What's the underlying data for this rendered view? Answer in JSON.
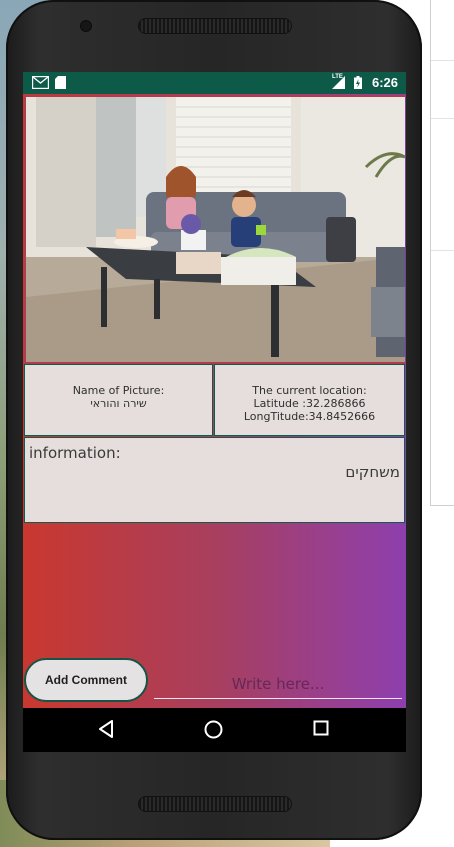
{
  "status_bar": {
    "time": "6:26",
    "network_label": "LTE",
    "icons": [
      "gmail-icon",
      "sd-card-icon",
      "signal-icon",
      "battery-charging-icon"
    ],
    "background_color": "#0e5a49"
  },
  "photo": {
    "subject": "photo-of-two-children-at-patio-table"
  },
  "picture_name": {
    "label": "Name of Picture:",
    "value": "שירה והוראי"
  },
  "location": {
    "label": "The current location:",
    "latitude_text": "Latitude :32.286866",
    "longitude_text": "LongTitude:34.8452666"
  },
  "description": {
    "label": "information:",
    "value": "משחקים"
  },
  "comment": {
    "button_label": "Add Comment",
    "input_placeholder": "Write here...",
    "input_value": ""
  },
  "nav_bar": {
    "items": [
      "back-icon",
      "home-icon",
      "recents-icon"
    ]
  },
  "colors": {
    "gradient_start": "#c9382f",
    "gradient_end": "#8e3fae",
    "box_border": "#125a4a",
    "box_background": "#e6dedd"
  }
}
